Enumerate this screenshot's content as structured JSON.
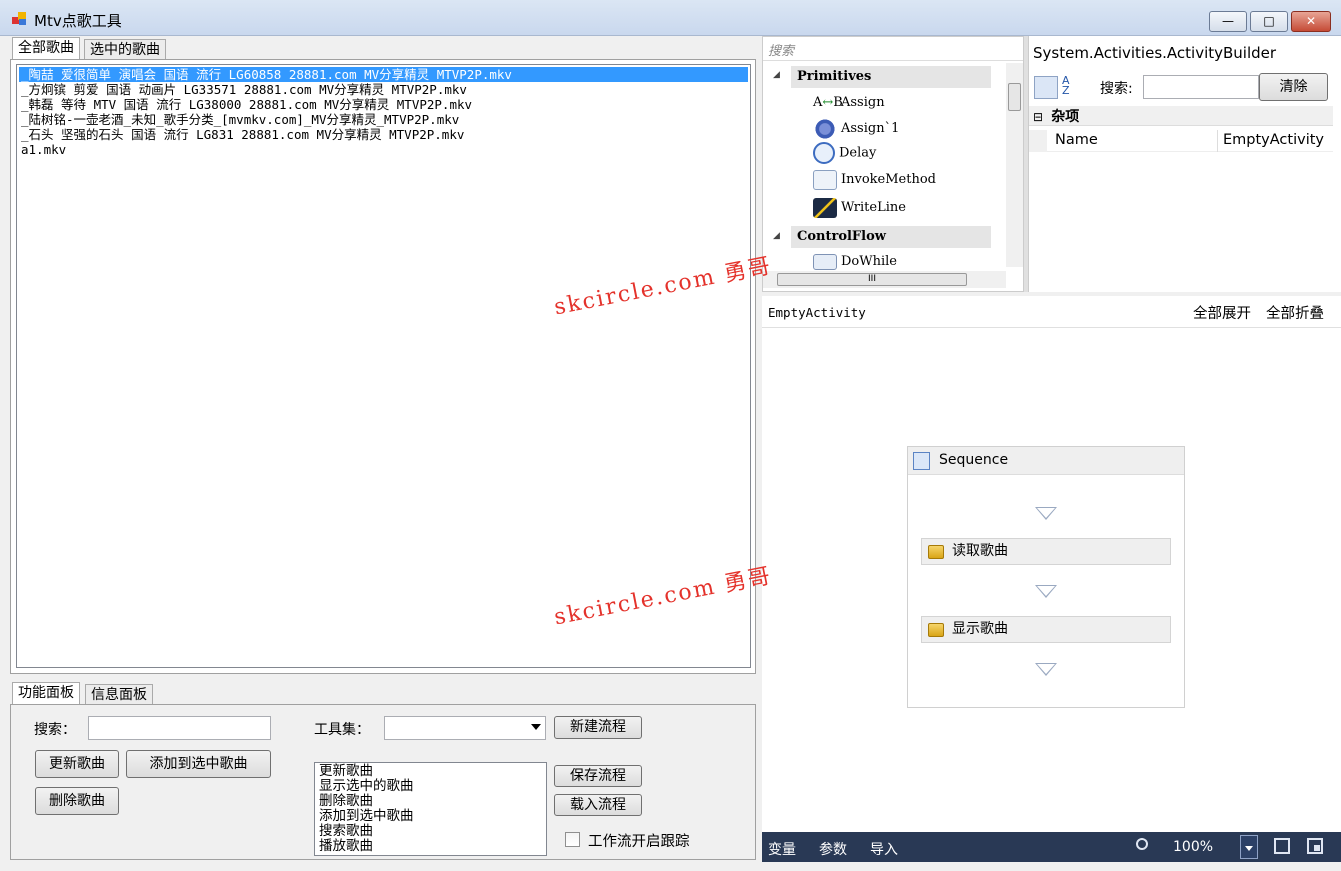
{
  "window": {
    "title": "Mtv点歌工具",
    "minimize": "—",
    "maximize": "□",
    "close": "✕"
  },
  "top_tabs": [
    "全部歌曲",
    "选中的歌曲"
  ],
  "songs": [
    "_陶喆 爱很简单 演唱会 国语 流行 LG60858 28881.com MV分享精灵 MTVP2P.mkv",
    "_方炯镔 剪爱 国语 动画片 LG33571 28881.com MV分享精灵 MTVP2P.mkv",
    "_韩磊 等待 MTV 国语 流行 LG38000 28881.com MV分享精灵 MTVP2P.mkv",
    "_陆树铭-一壶老酒_未知_歌手分类_[mvmkv.com]_MV分享精灵_MTVP2P.mkv",
    "_石头 坚强的石头 国语 流行 LG831 28881.com MV分享精灵 MTVP2P.mkv",
    "a1.mkv"
  ],
  "bottom_tabs": [
    "功能面板",
    "信息面板"
  ],
  "func_panel": {
    "search_label": "搜索：",
    "search_value": "",
    "toolset_label": "工具集：",
    "toolset_value": "",
    "btn_update": "更新歌曲",
    "btn_add_selected": "添加到选中歌曲",
    "btn_delete": "删除歌曲",
    "btn_new_flow": "新建流程",
    "btn_save_flow": "保存流程",
    "btn_load_flow": "载入流程",
    "tool_list": [
      "更新歌曲",
      "显示选中的歌曲",
      "删除歌曲",
      "添加到选中歌曲",
      "搜索歌曲",
      "播放歌曲"
    ],
    "trace_checkbox_label": "工作流开启跟踪",
    "trace_checked": false
  },
  "toolbox": {
    "search_placeholder": "搜索",
    "categories": [
      {
        "name": "Primitives",
        "items": [
          "Assign",
          "Assign`1",
          "Delay",
          "InvokeMethod",
          "WriteLine"
        ]
      },
      {
        "name": "ControlFlow",
        "items": [
          "DoWhile"
        ]
      }
    ],
    "collapse_glyph": "◢",
    "scroll_grip": "III"
  },
  "property_grid": {
    "title": "System.Activities.ActivityBuilder",
    "search_label": "搜索:",
    "search_value": "",
    "clear_button": "清除",
    "category": "杂项",
    "category_toggle": "⊟",
    "rows": [
      {
        "name": "Name",
        "value": "EmptyActivity"
      }
    ]
  },
  "designer": {
    "breadcrumb": "EmptyActivity",
    "expand_all": "全部展开",
    "collapse_all": "全部折叠",
    "sequence_title": "Sequence",
    "activities": [
      "读取歌曲",
      "显示歌曲"
    ]
  },
  "statusbar": {
    "variables": "变量",
    "arguments": "参数",
    "imports": "导入",
    "zoom": "100%"
  },
  "watermark": "skcircle.com 勇哥",
  "colors": {
    "selection": "#3399ff",
    "statusbar": "#293955",
    "watermark": "#e4322b"
  }
}
